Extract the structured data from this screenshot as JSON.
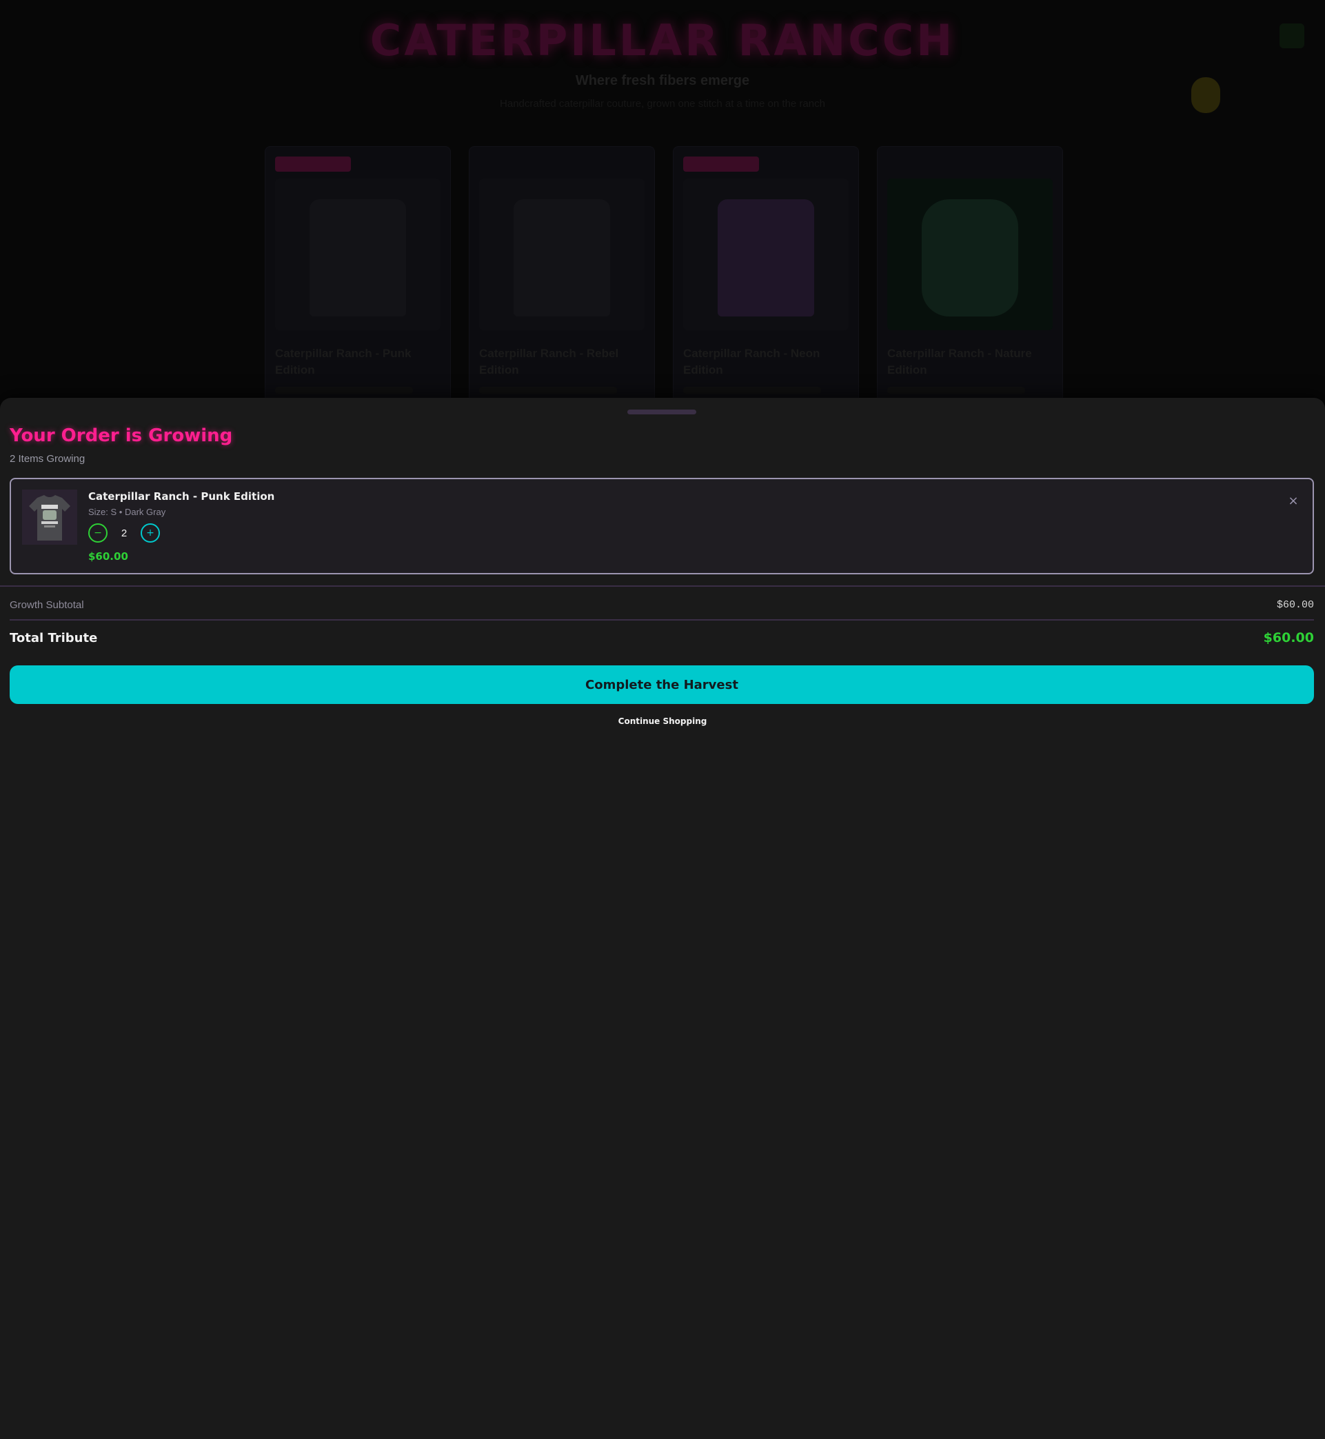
{
  "store": {
    "title": "CATERPILLAR RANCCH",
    "tagline": "Where fresh fibers emerge",
    "subtagline": "Handcrafted caterpillar couture, grown one stitch at a time on the ranch",
    "products": [
      {
        "name": "Caterpillar Ranch - Punk Edition",
        "has_badge": true
      },
      {
        "name": "Caterpillar Ranch - Rebel Edition",
        "has_badge": false
      },
      {
        "name": "Caterpillar Ranch - Neon Edition",
        "has_badge": true
      },
      {
        "name": "Caterpillar Ranch - Nature Edition",
        "has_badge": false
      }
    ]
  },
  "cart": {
    "title": "Your Order is Growing",
    "item_count_label": "2 Items Growing",
    "items": [
      {
        "name": "Caterpillar Ranch - Punk Edition",
        "variant": "Size: S • Dark Gray",
        "quantity": "2",
        "price": "$60.00",
        "decrement_symbol": "−",
        "increment_symbol": "+",
        "remove_symbol": "×",
        "thumbnail_icon": "tshirt-icon"
      }
    ],
    "subtotal_label": "Growth Subtotal",
    "subtotal_value": "$60.00",
    "total_label": "Total Tribute",
    "total_value": "$60.00",
    "checkout_label": "Complete the Harvest",
    "continue_label": "Continue Shopping"
  },
  "colors": {
    "accent_pink": "#ff1f8f",
    "accent_cyan": "#00c9cd",
    "accent_green": "#2ed136",
    "sheet_background": "#1a1a1a"
  }
}
